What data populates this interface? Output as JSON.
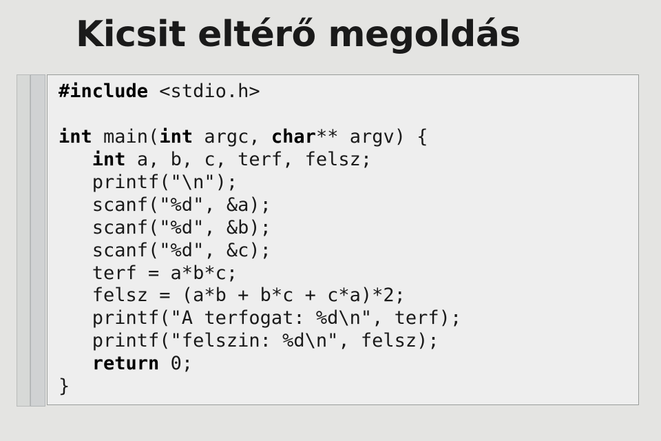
{
  "slide": {
    "title": "Kicsit eltérő megoldás",
    "code": {
      "l01a": "#include",
      "l01b": " <stdio.h>",
      "l02": "",
      "l03a": "int",
      "l03b": " main(",
      "l03c": "int",
      "l03d": " argc, ",
      "l03e": "char",
      "l03f": "** argv) {",
      "l04a": "   ",
      "l04b": "int",
      "l04c": " a, b, c, terf, felsz;",
      "l05": "   printf(\"\\n\");",
      "l06": "   scanf(\"%d\", &a);",
      "l07": "   scanf(\"%d\", &b);",
      "l08": "   scanf(\"%d\", &c);",
      "l09": "   terf = a*b*c;",
      "l10": "   felsz = (a*b + b*c + c*a)*2;",
      "l11": "   printf(\"A terfogat: %d\\n\", terf);",
      "l12": "   printf(\"felszin: %d\\n\", felsz);",
      "l13a": "   ",
      "l13b": "return",
      "l13c": " 0;",
      "l14": "}"
    }
  }
}
